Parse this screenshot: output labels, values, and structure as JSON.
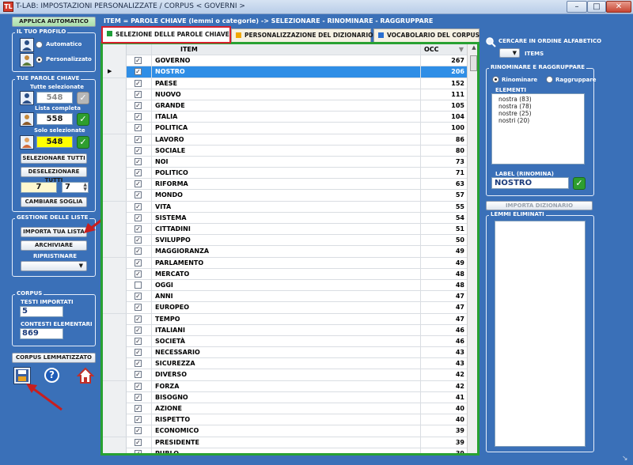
{
  "window": {
    "title": "T-LAB: IMPOSTAZIONI PERSONALIZZATE  /  CORPUS < GOVERNI >",
    "app_icon_label": "TL"
  },
  "left": {
    "apply_button": "APPLICA AUTOMATICO",
    "profile": {
      "title": "IL TUO PROFILO",
      "auto": "Automatico",
      "custom": "Personalizzato"
    },
    "keywords": {
      "title": "TUE PAROLE CHIAVE",
      "all_label": "Tutte selezionate",
      "all_value": "548",
      "list_label": "Lista completa",
      "list_value": "558",
      "only_label": "Solo selezionate",
      "only_value": "548",
      "select_all": "SELEZIONARE TUTTI",
      "deselect_all": "DESELEZIONARE TUTTI",
      "threshold_a": "7",
      "threshold_b": "7",
      "change_threshold": "CAMBIARE SOGLIA"
    },
    "lists": {
      "title": "GESTIONE DELLE LISTE",
      "import": "IMPORTA TUA LISTA",
      "archive": "ARCHIVIARE",
      "restore_label": "RIPRISTINARE"
    },
    "corpus": {
      "title": "CORPUS",
      "texts_label": "TESTI IMPORTATI",
      "texts_value": "5",
      "contexts_label": "CONTESTI ELEMENTARI",
      "contexts_value": "869"
    },
    "lemmatized_button": "CORPUS LEMMATIZZATO"
  },
  "header": "ITEM = PAROLE CHIAVE (lemmi o categorie) -> SELEZIONARE - RINOMINARE - RAGGRUPPARE",
  "tabs": [
    {
      "label": "SELEZIONE DELLE PAROLE CHIAVE",
      "color": "#1f9e3a"
    },
    {
      "label": "PERSONALIZZAZIONE DEL DIZIONARIO",
      "color": "#f0a800"
    },
    {
      "label": "VOCABOLARIO DEL CORPUS",
      "color": "#2a6fd0"
    }
  ],
  "table": {
    "columns": [
      "ITEM",
      "OCC"
    ],
    "rows": [
      {
        "item": "GOVERNO",
        "occ": "267",
        "checked": true
      },
      {
        "item": "NOSTRO",
        "occ": "206",
        "checked": true,
        "selected": true
      },
      {
        "item": "PAESE",
        "occ": "152",
        "checked": true
      },
      {
        "item": "NUOVO",
        "occ": "111",
        "checked": true
      },
      {
        "item": "GRANDE",
        "occ": "105",
        "checked": true
      },
      {
        "item": "ITALIA",
        "occ": "104",
        "checked": true
      },
      {
        "item": "POLITICA",
        "occ": "100",
        "checked": true
      },
      {
        "item": "LAVORO",
        "occ": "86",
        "checked": true
      },
      {
        "item": "SOCIALE",
        "occ": "80",
        "checked": true
      },
      {
        "item": "NOI",
        "occ": "73",
        "checked": true
      },
      {
        "item": "POLITICO",
        "occ": "71",
        "checked": true
      },
      {
        "item": "RIFORMA",
        "occ": "63",
        "checked": true
      },
      {
        "item": "MONDO",
        "occ": "57",
        "checked": true
      },
      {
        "item": "VITA",
        "occ": "55",
        "checked": true
      },
      {
        "item": "SISTEMA",
        "occ": "54",
        "checked": true
      },
      {
        "item": "CITTADINI",
        "occ": "51",
        "checked": true
      },
      {
        "item": "SVILUPPO",
        "occ": "50",
        "checked": true
      },
      {
        "item": "MAGGIORANZA",
        "occ": "49",
        "checked": true
      },
      {
        "item": "PARLAMENTO",
        "occ": "49",
        "checked": true
      },
      {
        "item": "MERCATO",
        "occ": "48",
        "checked": true
      },
      {
        "item": "OGGI",
        "occ": "48",
        "checked": false
      },
      {
        "item": "ANNI",
        "occ": "47",
        "checked": true
      },
      {
        "item": "EUROPEO",
        "occ": "47",
        "checked": true
      },
      {
        "item": "TEMPO",
        "occ": "47",
        "checked": true
      },
      {
        "item": "ITALIANI",
        "occ": "46",
        "checked": true
      },
      {
        "item": "SOCIETÀ",
        "occ": "46",
        "checked": true
      },
      {
        "item": "NECESSARIO",
        "occ": "43",
        "checked": true
      },
      {
        "item": "SICUREZZA",
        "occ": "43",
        "checked": true
      },
      {
        "item": "DIVERSO",
        "occ": "42",
        "checked": true
      },
      {
        "item": "FORZA",
        "occ": "42",
        "checked": true
      },
      {
        "item": "BISOGNO",
        "occ": "41",
        "checked": true
      },
      {
        "item": "AZIONE",
        "occ": "40",
        "checked": true
      },
      {
        "item": "RISPETTO",
        "occ": "40",
        "checked": true
      },
      {
        "item": "ECONOMICO",
        "occ": "39",
        "checked": true
      },
      {
        "item": "PRESIDENTE",
        "occ": "39",
        "checked": true
      },
      {
        "item": "PUBLO",
        "occ": "39",
        "checked": true
      }
    ]
  },
  "right": {
    "alpha_label": "CERCARE IN ORDINE ALFABETICO",
    "items_label": "ITEMS",
    "group": {
      "title": "RINOMINARE E RAGGRUPPARE",
      "rename": "Rinominare",
      "group": "Raggruppare",
      "elements_label": "ELEMENTI",
      "elements": [
        "nostra (83)",
        "nostra (78)",
        "nostre (25)",
        "nostri (20)"
      ],
      "label_title": "LABEL (RINOMINA)",
      "label_value": "NOSTRO"
    },
    "import_dict": "IMPORTA DIZIONARIO",
    "eliminated_title": "LEMMI ELIMINATI"
  },
  "colors": {
    "background": "#3a70b8",
    "accent_red": "#d61f2c",
    "accent_green": "#28a132",
    "selected_row": "#2f8ee6"
  }
}
